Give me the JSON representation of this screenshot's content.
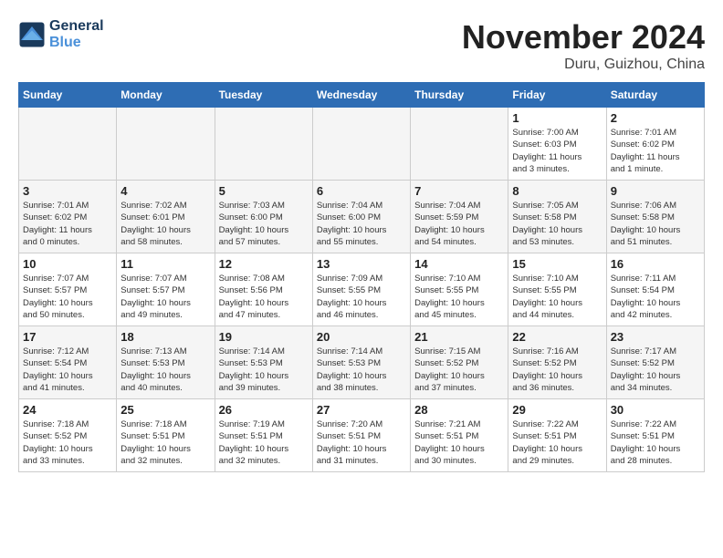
{
  "header": {
    "logo_line1": "General",
    "logo_line2": "Blue",
    "month": "November 2024",
    "location": "Duru, Guizhou, China"
  },
  "weekdays": [
    "Sunday",
    "Monday",
    "Tuesday",
    "Wednesday",
    "Thursday",
    "Friday",
    "Saturday"
  ],
  "weeks": [
    [
      {
        "day": "",
        "info": "",
        "empty": true
      },
      {
        "day": "",
        "info": "",
        "empty": true
      },
      {
        "day": "",
        "info": "",
        "empty": true
      },
      {
        "day": "",
        "info": "",
        "empty": true
      },
      {
        "day": "",
        "info": "",
        "empty": true
      },
      {
        "day": "1",
        "info": "Sunrise: 7:00 AM\nSunset: 6:03 PM\nDaylight: 11 hours\nand 3 minutes.",
        "empty": false
      },
      {
        "day": "2",
        "info": "Sunrise: 7:01 AM\nSunset: 6:02 PM\nDaylight: 11 hours\nand 1 minute.",
        "empty": false
      }
    ],
    [
      {
        "day": "3",
        "info": "Sunrise: 7:01 AM\nSunset: 6:02 PM\nDaylight: 11 hours\nand 0 minutes.",
        "empty": false
      },
      {
        "day": "4",
        "info": "Sunrise: 7:02 AM\nSunset: 6:01 PM\nDaylight: 10 hours\nand 58 minutes.",
        "empty": false
      },
      {
        "day": "5",
        "info": "Sunrise: 7:03 AM\nSunset: 6:00 PM\nDaylight: 10 hours\nand 57 minutes.",
        "empty": false
      },
      {
        "day": "6",
        "info": "Sunrise: 7:04 AM\nSunset: 6:00 PM\nDaylight: 10 hours\nand 55 minutes.",
        "empty": false
      },
      {
        "day": "7",
        "info": "Sunrise: 7:04 AM\nSunset: 5:59 PM\nDaylight: 10 hours\nand 54 minutes.",
        "empty": false
      },
      {
        "day": "8",
        "info": "Sunrise: 7:05 AM\nSunset: 5:58 PM\nDaylight: 10 hours\nand 53 minutes.",
        "empty": false
      },
      {
        "day": "9",
        "info": "Sunrise: 7:06 AM\nSunset: 5:58 PM\nDaylight: 10 hours\nand 51 minutes.",
        "empty": false
      }
    ],
    [
      {
        "day": "10",
        "info": "Sunrise: 7:07 AM\nSunset: 5:57 PM\nDaylight: 10 hours\nand 50 minutes.",
        "empty": false
      },
      {
        "day": "11",
        "info": "Sunrise: 7:07 AM\nSunset: 5:57 PM\nDaylight: 10 hours\nand 49 minutes.",
        "empty": false
      },
      {
        "day": "12",
        "info": "Sunrise: 7:08 AM\nSunset: 5:56 PM\nDaylight: 10 hours\nand 47 minutes.",
        "empty": false
      },
      {
        "day": "13",
        "info": "Sunrise: 7:09 AM\nSunset: 5:55 PM\nDaylight: 10 hours\nand 46 minutes.",
        "empty": false
      },
      {
        "day": "14",
        "info": "Sunrise: 7:10 AM\nSunset: 5:55 PM\nDaylight: 10 hours\nand 45 minutes.",
        "empty": false
      },
      {
        "day": "15",
        "info": "Sunrise: 7:10 AM\nSunset: 5:55 PM\nDaylight: 10 hours\nand 44 minutes.",
        "empty": false
      },
      {
        "day": "16",
        "info": "Sunrise: 7:11 AM\nSunset: 5:54 PM\nDaylight: 10 hours\nand 42 minutes.",
        "empty": false
      }
    ],
    [
      {
        "day": "17",
        "info": "Sunrise: 7:12 AM\nSunset: 5:54 PM\nDaylight: 10 hours\nand 41 minutes.",
        "empty": false
      },
      {
        "day": "18",
        "info": "Sunrise: 7:13 AM\nSunset: 5:53 PM\nDaylight: 10 hours\nand 40 minutes.",
        "empty": false
      },
      {
        "day": "19",
        "info": "Sunrise: 7:14 AM\nSunset: 5:53 PM\nDaylight: 10 hours\nand 39 minutes.",
        "empty": false
      },
      {
        "day": "20",
        "info": "Sunrise: 7:14 AM\nSunset: 5:53 PM\nDaylight: 10 hours\nand 38 minutes.",
        "empty": false
      },
      {
        "day": "21",
        "info": "Sunrise: 7:15 AM\nSunset: 5:52 PM\nDaylight: 10 hours\nand 37 minutes.",
        "empty": false
      },
      {
        "day": "22",
        "info": "Sunrise: 7:16 AM\nSunset: 5:52 PM\nDaylight: 10 hours\nand 36 minutes.",
        "empty": false
      },
      {
        "day": "23",
        "info": "Sunrise: 7:17 AM\nSunset: 5:52 PM\nDaylight: 10 hours\nand 34 minutes.",
        "empty": false
      }
    ],
    [
      {
        "day": "24",
        "info": "Sunrise: 7:18 AM\nSunset: 5:52 PM\nDaylight: 10 hours\nand 33 minutes.",
        "empty": false
      },
      {
        "day": "25",
        "info": "Sunrise: 7:18 AM\nSunset: 5:51 PM\nDaylight: 10 hours\nand 32 minutes.",
        "empty": false
      },
      {
        "day": "26",
        "info": "Sunrise: 7:19 AM\nSunset: 5:51 PM\nDaylight: 10 hours\nand 32 minutes.",
        "empty": false
      },
      {
        "day": "27",
        "info": "Sunrise: 7:20 AM\nSunset: 5:51 PM\nDaylight: 10 hours\nand 31 minutes.",
        "empty": false
      },
      {
        "day": "28",
        "info": "Sunrise: 7:21 AM\nSunset: 5:51 PM\nDaylight: 10 hours\nand 30 minutes.",
        "empty": false
      },
      {
        "day": "29",
        "info": "Sunrise: 7:22 AM\nSunset: 5:51 PM\nDaylight: 10 hours\nand 29 minutes.",
        "empty": false
      },
      {
        "day": "30",
        "info": "Sunrise: 7:22 AM\nSunset: 5:51 PM\nDaylight: 10 hours\nand 28 minutes.",
        "empty": false
      }
    ]
  ]
}
